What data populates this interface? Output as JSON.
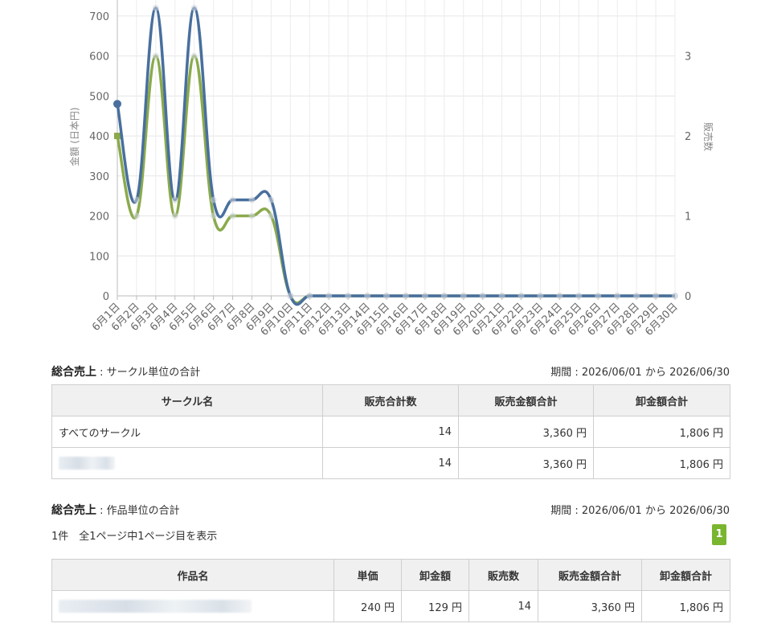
{
  "chart_data": {
    "type": "line",
    "categories": [
      "6月1日",
      "6月2日",
      "6月3日",
      "6月4日",
      "6月5日",
      "6月6日",
      "6月7日",
      "6月8日",
      "6月9日",
      "6月10日",
      "6月11日",
      "6月12日",
      "6月13日",
      "6月14日",
      "6月15日",
      "6月16日",
      "6月17日",
      "6月18日",
      "6月19日",
      "6月20日",
      "6月21日",
      "6月22日",
      "6月23日",
      "6月24日",
      "6月25日",
      "6月26日",
      "6月27日",
      "6月28日",
      "6月29日",
      "6月30日"
    ],
    "series": [
      {
        "axis": "left",
        "color": "#486f9e",
        "values": [
          480,
          240,
          720,
          240,
          720,
          240,
          240,
          240,
          240,
          0,
          0,
          0,
          0,
          0,
          0,
          0,
          0,
          0,
          0,
          0,
          0,
          0,
          0,
          0,
          0,
          0,
          0,
          0,
          0,
          0
        ]
      },
      {
        "axis": "left",
        "color": "#8aaa4c",
        "values": [
          400,
          200,
          600,
          200,
          600,
          200,
          200,
          200,
          200,
          0,
          0,
          0,
          0,
          0,
          0,
          0,
          0,
          0,
          0,
          0,
          0,
          0,
          0,
          0,
          0,
          0,
          0,
          0,
          0,
          0
        ]
      }
    ],
    "ylabel": "金額 (日本円)",
    "y2label": "販売数",
    "ylim": [
      0,
      700
    ],
    "yticks": [
      "0",
      "100",
      "200",
      "300",
      "400",
      "500",
      "600",
      "700"
    ],
    "y2ticks": [
      "0",
      "1",
      "2",
      "3"
    ],
    "grid": true
  },
  "circle_summary": {
    "title": "総合売上",
    "subtitle": " : サークル単位の合計",
    "period": "期間 : 2026/06/01 から 2026/06/30",
    "headers": [
      "サークル名",
      "販売合計数",
      "販売金額合計",
      "卸金額合計"
    ],
    "rows": [
      [
        "すべてのサークル",
        "14",
        "3,360 円",
        "1,806 円"
      ],
      [
        "",
        "14",
        "3,360 円",
        "1,806 円"
      ]
    ]
  },
  "work_summary": {
    "title": "総合売上",
    "subtitle": " : 作品単位の合計",
    "period": "期間 : 2026/06/01 から 2026/06/30",
    "count_text": "1件　全1ページ中1ページ目を表示",
    "page_label": "1",
    "headers": [
      "作品名",
      "単価",
      "卸金額",
      "販売数",
      "販売金額合計",
      "卸金額合計"
    ],
    "rows": [
      [
        "",
        "240 円",
        "129 円",
        "14",
        "3,360 円",
        "1,806 円"
      ]
    ]
  }
}
